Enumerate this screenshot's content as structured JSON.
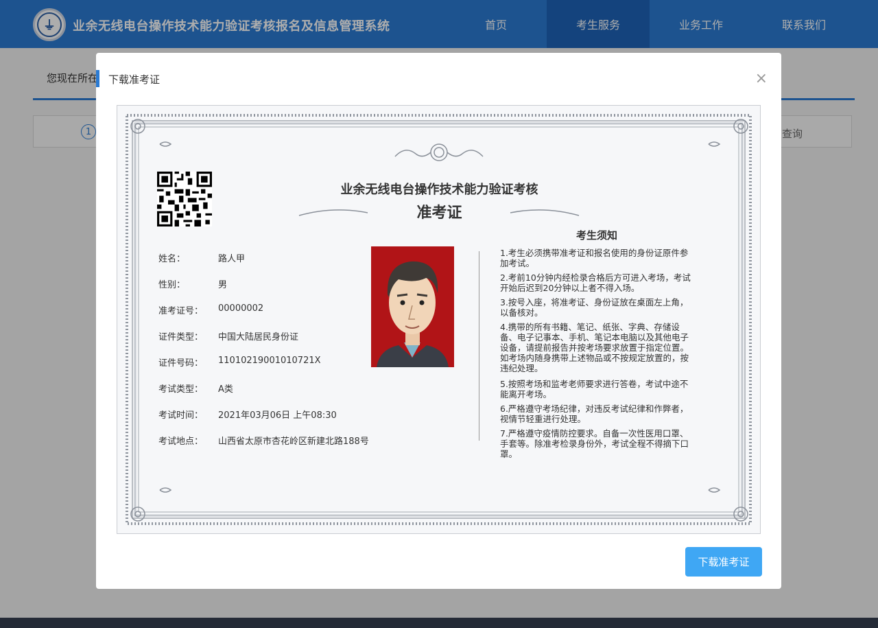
{
  "header": {
    "site_title": "业余无线电台操作技术能力验证考核报名及信息管理系统",
    "nav": [
      "首页",
      "考生服务",
      "业务工作",
      "联系我们"
    ],
    "active_nav": "考生服务"
  },
  "page": {
    "breadcrumb": "您现在所在",
    "step_number": "1",
    "step_query_label": "查询"
  },
  "modal": {
    "title": "下载准考证",
    "close_symbol": "×",
    "download_button": "下载准考证"
  },
  "card": {
    "title": "业余无线电台操作技术能力验证考核",
    "subtitle": "准考证",
    "fields": [
      {
        "label": "姓名：",
        "value": "路人甲"
      },
      {
        "label": "性别：",
        "value": "男"
      },
      {
        "label": "准考证号：",
        "value": "00000002"
      },
      {
        "label": "证件类型：",
        "value": "中国大陆居民身份证"
      },
      {
        "label": "证件号码：",
        "value": "11010219001010721X"
      },
      {
        "label": "考试类型：",
        "value": "A类"
      },
      {
        "label": "考试时间：",
        "value": "2021年03月06日 上午08:30"
      },
      {
        "label": "考试地点：",
        "value": "山西省太原市杏花岭区新建北路188号"
      }
    ],
    "notice_title": "考生须知",
    "notices": [
      "1.考生必须携带准考证和报名使用的身份证原件参加考试。",
      "2.考前10分钟内经检录合格后方可进入考场，考试开始后迟到20分钟以上者不得入场。",
      "3.按号入座，将准考证、身份证放在桌面左上角，以备核对。",
      "4.携带的所有书籍、笔记、纸张、字典、存储设备、电子记事本、手机、笔记本电脑以及其他电子设备，请提前报告并按考场要求放置于指定位置。如考场内随身携带上述物品或不按规定放置的，按违纪处理。",
      "5.按照考场和监考老师要求进行答卷，考试中途不能离开考场。",
      "6.严格遵守考场纪律，对违反考试纪律和作弊者，视情节轻重进行处理。",
      "7.严格遵守疫情防控要求。自备一次性医用口罩、手套等。除准考检录身份外，考试全程不得摘下口罩。"
    ]
  },
  "colors": {
    "header_bg": "#2b7bd3",
    "nav_active_bg": "#1e64b8",
    "accent": "#2b7bd3",
    "button_bg": "#3fa7f4",
    "photo_bg": "#b11417",
    "footer_bg": "#242a36"
  }
}
